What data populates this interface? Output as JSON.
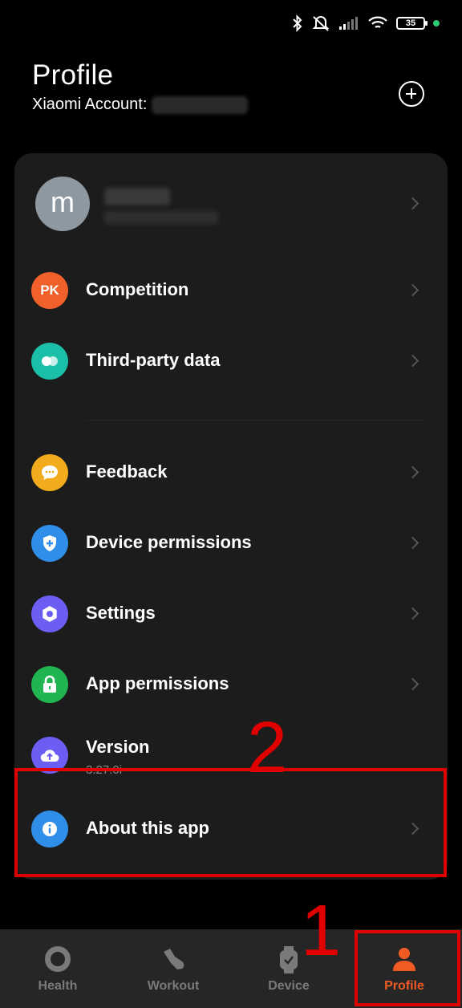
{
  "status_bar": {
    "battery": "35"
  },
  "header": {
    "title": "Profile",
    "account_label": "Xiaomi Account:"
  },
  "user": {
    "avatar_initial": "m"
  },
  "menu": {
    "competition": {
      "label": "Competition",
      "icon_text": "PK",
      "color": "#f0602a"
    },
    "third_party": {
      "label": "Third-party data",
      "color": "#1bbfa8"
    },
    "feedback": {
      "label": "Feedback",
      "color": "#f2ab1c"
    },
    "device_permissions": {
      "label": "Device permissions",
      "color": "#2f8ee8"
    },
    "settings": {
      "label": "Settings",
      "color": "#6c5ef2"
    },
    "app_permissions": {
      "label": "App permissions",
      "color": "#21b552"
    },
    "version": {
      "label": "Version",
      "value": "3.27.0i",
      "color": "#6c5ef2"
    },
    "about": {
      "label": "About this app",
      "color": "#2f8ee8"
    }
  },
  "annotations": {
    "step1": "1",
    "step2": "2"
  },
  "nav": {
    "health": "Health",
    "workout": "Workout",
    "device": "Device",
    "profile": "Profile"
  },
  "colors": {
    "accent": "#f05a23",
    "annotation": "#e00000"
  }
}
